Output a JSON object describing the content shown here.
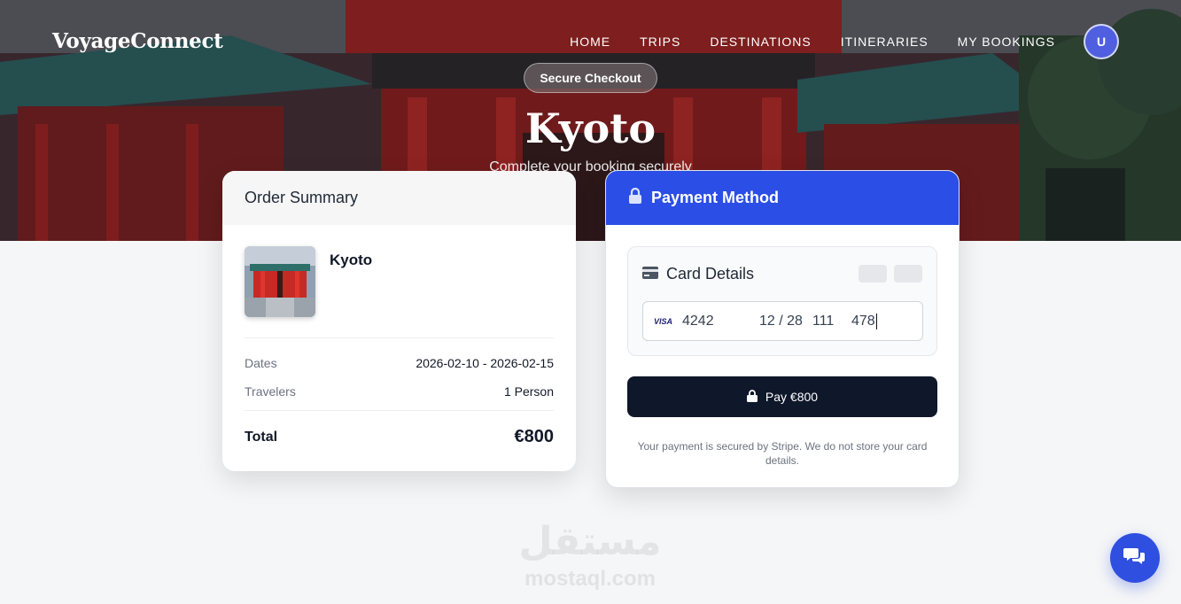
{
  "nav": {
    "brand": "VoyageConnect",
    "links": [
      "HOME",
      "TRIPS",
      "DESTINATIONS",
      "ITINERARIES",
      "MY BOOKINGS"
    ],
    "avatar_initial": "U"
  },
  "hero": {
    "badge": "Secure Checkout",
    "title": "Kyoto",
    "subtitle": "Complete your booking securely"
  },
  "summary": {
    "heading": "Order Summary",
    "trip_name": "Kyoto",
    "dates_label": "Dates",
    "dates_value": "2026-02-10 - 2026-02-15",
    "travelers_label": "Travelers",
    "travelers_value": "1 Person",
    "total_label": "Total",
    "total_value": "€800"
  },
  "payment": {
    "heading": "Payment Method",
    "card_details_label": "Card Details",
    "card_brand": "VISA",
    "card_number": "4242",
    "expiry": "12 / 28",
    "cvc": "111",
    "zip": "478",
    "pay_button": "Pay €800",
    "note": "Your payment is secured by Stripe. We do not store your card details."
  },
  "watermark": {
    "arabic": "مستقل",
    "latin": "mostaql.com"
  },
  "colors": {
    "accent": "#2b4ee6",
    "button_dark": "#0f172a",
    "avatar": "#4f5fe0"
  },
  "icons": [
    "lock-icon",
    "credit-card-icon",
    "chat-icon"
  ]
}
